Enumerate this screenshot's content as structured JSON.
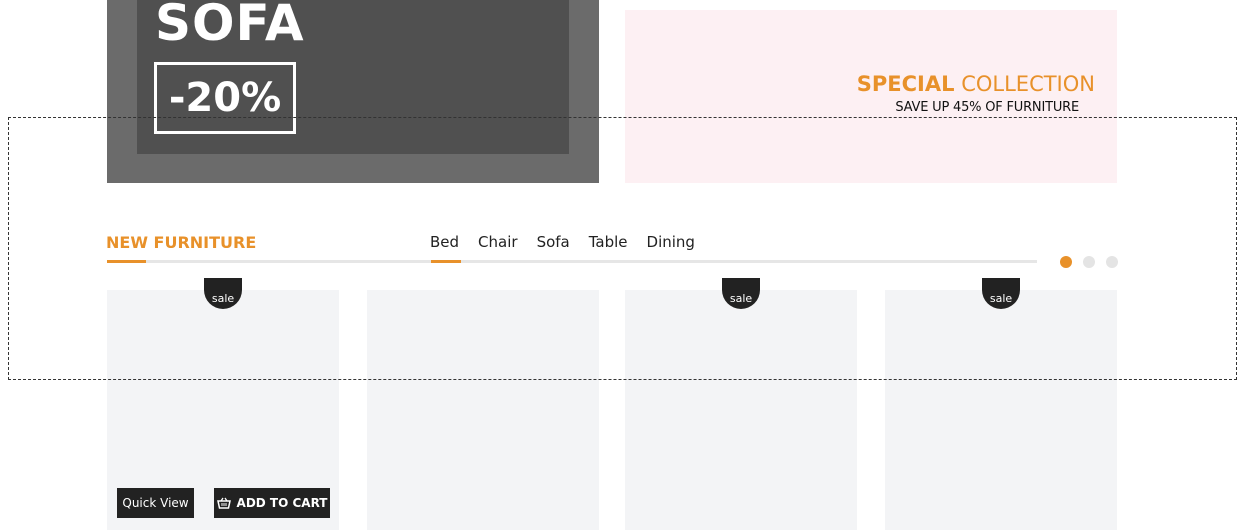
{
  "banner_left": {
    "title": "SOFA",
    "discount": "-20%"
  },
  "banner_right": {
    "special_bold": "SPECIAL",
    "special_light": "COLLECTION",
    "subtitle": "SAVE UP 45% OF FURNITURE"
  },
  "section": {
    "title": "NEW FURNITURE",
    "tabs": [
      {
        "label": "Bed",
        "active": true
      },
      {
        "label": "Chair"
      },
      {
        "label": "Sofa"
      },
      {
        "label": "Table"
      },
      {
        "label": "Dining"
      }
    ],
    "pagination": {
      "pages": 3,
      "current": 1
    }
  },
  "products": [
    {
      "badge": "sale",
      "quick_view": "Quick View",
      "add_to_cart": "ADD TO CART"
    },
    {
      "badge": ""
    },
    {
      "badge": "sale"
    },
    {
      "badge": "sale"
    }
  ],
  "colors": {
    "accent": "#e8912a",
    "dark": "#222222",
    "card_bg": "#f3f4f6",
    "banner_pink": "#fdf0f3"
  }
}
